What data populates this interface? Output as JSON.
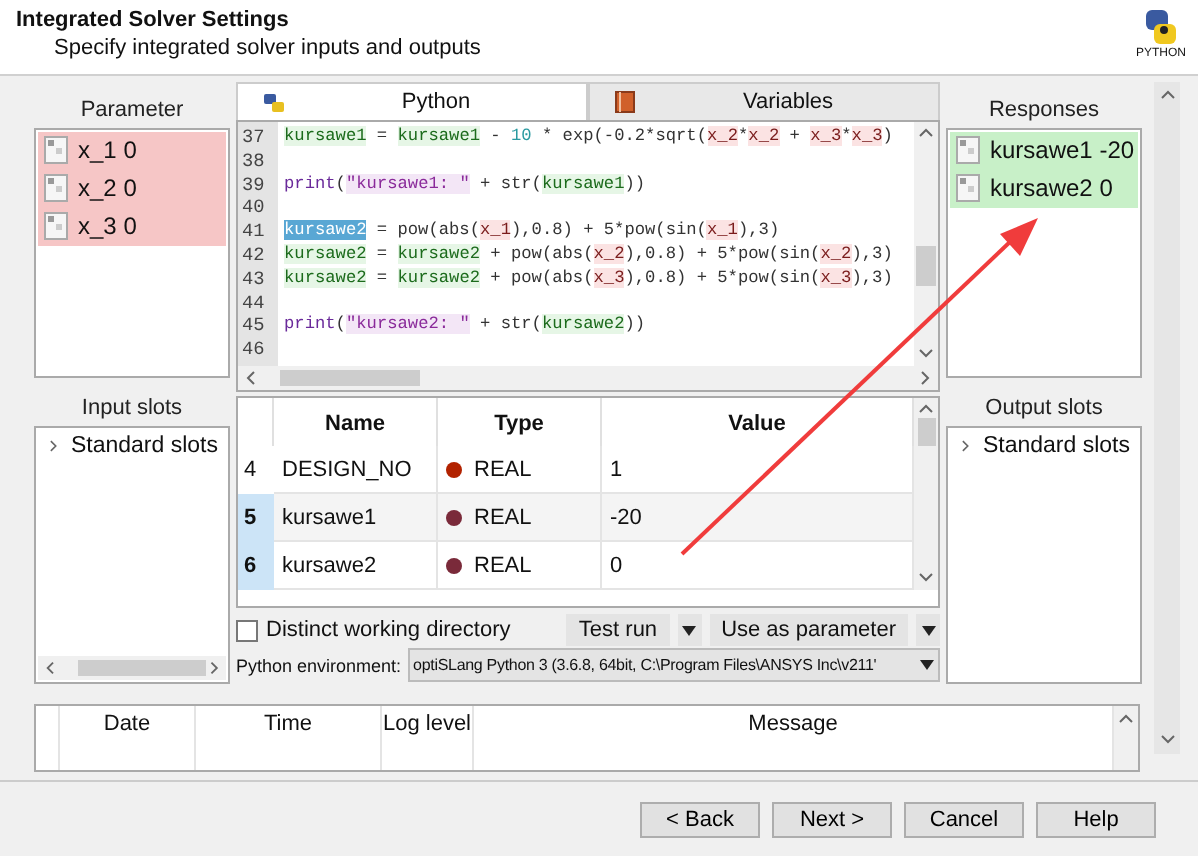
{
  "header": {
    "title": "Integrated Solver Settings",
    "subtitle": "Specify integrated solver inputs and outputs",
    "logo_text": "PYTHON"
  },
  "parameters": {
    "label": "Parameter",
    "items": [
      {
        "name": "x_1",
        "value": "0"
      },
      {
        "name": "x_2",
        "value": "0"
      },
      {
        "name": "x_3",
        "value": "0"
      }
    ]
  },
  "input_slots": {
    "label": "Input slots",
    "items": [
      {
        "label": "Standard slots",
        "expanded": false
      }
    ]
  },
  "tabs": [
    {
      "label": "Python",
      "kind": "python",
      "selected": true
    },
    {
      "label": "Variables",
      "kind": "book",
      "selected": false
    }
  ],
  "code": [
    {
      "number": "37",
      "tokens": [
        {
          "text": "kursawe1",
          "kind": "var"
        },
        {
          "text": " = ",
          "kind": "plain"
        },
        {
          "text": "kursawe1",
          "kind": "var"
        },
        {
          "text": " - ",
          "kind": "plain"
        },
        {
          "text": "10",
          "kind": "num"
        },
        {
          "text": " * exp(-0.2*sqrt(",
          "kind": "plain"
        },
        {
          "text": "x_2",
          "kind": "par"
        },
        {
          "text": "*",
          "kind": "plain"
        },
        {
          "text": "x_2",
          "kind": "par"
        },
        {
          "text": " + ",
          "kind": "plain"
        },
        {
          "text": "x_3",
          "kind": "par"
        },
        {
          "text": "*",
          "kind": "plain"
        },
        {
          "text": "x_3",
          "kind": "par"
        },
        {
          "text": ")",
          "kind": "plain"
        }
      ]
    },
    {
      "number": "38"
    },
    {
      "number": "39",
      "tokens": [
        {
          "text": "print",
          "kind": "kw"
        },
        {
          "text": "(",
          "kind": "plain"
        },
        {
          "text": "\"kursawe1: \"",
          "kind": "str"
        },
        {
          "text": " + str(",
          "kind": "plain"
        },
        {
          "text": "kursawe1",
          "kind": "var"
        },
        {
          "text": "))",
          "kind": "plain"
        }
      ]
    },
    {
      "number": "40"
    },
    {
      "number": "41",
      "tokens": [
        {
          "text": "kursawe2",
          "kind": "sel"
        },
        {
          "text": " = pow(abs(",
          "kind": "plain"
        },
        {
          "text": "x_1",
          "kind": "par"
        },
        {
          "text": "),0.8) + 5*pow(sin(",
          "kind": "plain"
        },
        {
          "text": "x_1",
          "kind": "par"
        },
        {
          "text": "),3)",
          "kind": "plain"
        }
      ]
    },
    {
      "number": "42",
      "tokens": [
        {
          "text": "kursawe2",
          "kind": "var"
        },
        {
          "text": " = ",
          "kind": "plain"
        },
        {
          "text": "kursawe2",
          "kind": "var"
        },
        {
          "text": " + pow(abs(",
          "kind": "plain"
        },
        {
          "text": "x_2",
          "kind": "par"
        },
        {
          "text": "),0.8) + 5*pow(sin(",
          "kind": "plain"
        },
        {
          "text": "x_2",
          "kind": "par"
        },
        {
          "text": "),3)",
          "kind": "plain"
        }
      ]
    },
    {
      "number": "43",
      "tokens": [
        {
          "text": "kursawe2",
          "kind": "var"
        },
        {
          "text": " = ",
          "kind": "plain"
        },
        {
          "text": "kursawe2",
          "kind": "var"
        },
        {
          "text": " + pow(abs(",
          "kind": "plain"
        },
        {
          "text": "x_3",
          "kind": "par"
        },
        {
          "text": "),0.8) + 5*pow(sin(",
          "kind": "plain"
        },
        {
          "text": "x_3",
          "kind": "par"
        },
        {
          "text": "),3)",
          "kind": "plain"
        }
      ]
    },
    {
      "number": "44"
    },
    {
      "number": "45",
      "tokens": [
        {
          "text": "print",
          "kind": "kw"
        },
        {
          "text": "(",
          "kind": "plain"
        },
        {
          "text": "\"kursawe2: \"",
          "kind": "str"
        },
        {
          "text": " + str(",
          "kind": "plain"
        },
        {
          "text": "kursawe2",
          "kind": "var"
        },
        {
          "text": "))",
          "kind": "plain"
        }
      ]
    },
    {
      "number": "46"
    }
  ],
  "variables": {
    "columns": [
      "Name",
      "Type",
      "Value"
    ],
    "rows": [
      {
        "number": "4",
        "name": "DESIGN_NO",
        "type": "REAL",
        "color": "#b22200",
        "value": "1",
        "selected": false
      },
      {
        "number": "5",
        "name": "kursawe1",
        "type": "REAL",
        "color": "#7a2a3a",
        "value": "-20",
        "selected": true
      },
      {
        "number": "6",
        "name": "kursawe2",
        "type": "REAL",
        "color": "#7a2a3a",
        "value": "0",
        "selected": true
      }
    ]
  },
  "distinct_working_directory": {
    "label": "Distinct working directory",
    "checked": false
  },
  "test_run": "Test run",
  "use_as_parameter": "Use as parameter",
  "python_environment": {
    "label": "Python environment:",
    "value": "optiSLang Python 3 (3.6.8, 64bit, C:\\Program Files\\ANSYS Inc\\v211'"
  },
  "responses": {
    "label": "Responses",
    "items": [
      {
        "name": "kursawe1",
        "value": "-20"
      },
      {
        "name": "kursawe2",
        "value": "0"
      }
    ]
  },
  "output_slots": {
    "label": "Output slots",
    "items": [
      {
        "label": "Standard slots",
        "expanded": false
      }
    ]
  },
  "log": {
    "columns": [
      "Date",
      "Time",
      "Log level",
      "Message"
    ]
  },
  "buttons": [
    "< Back",
    "Next >",
    "Cancel",
    "Help"
  ]
}
